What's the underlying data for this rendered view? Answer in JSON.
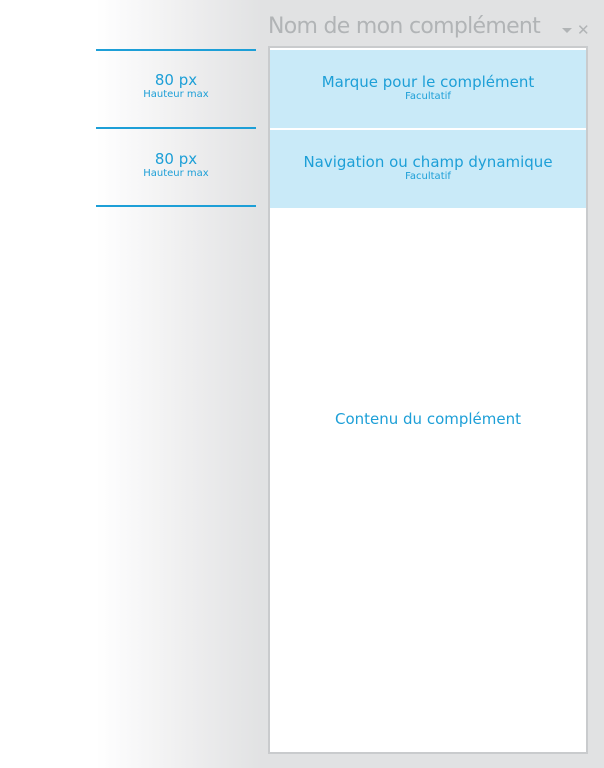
{
  "header": {
    "title": "Nom de mon complément",
    "dropdown_icon": "chevron-down-icon",
    "close_icon": "close-icon",
    "close_glyph": "✕"
  },
  "bands": [
    {
      "title": "Marque pour le complément",
      "subtitle": "Facultatif"
    },
    {
      "title": "Navigation ou champ dynamique",
      "subtitle": "Facultatif"
    }
  ],
  "content": {
    "label": "Contenu du complément"
  },
  "measurements": [
    {
      "value": "80 px",
      "label": "Hauteur max"
    },
    {
      "value": "80 px",
      "label": "Hauteur max"
    }
  ],
  "colors": {
    "accent": "#1d9fd7",
    "band_bg": "#c9eaf8",
    "title_text": "#b1b4b6",
    "pane_border": "#c9cbcd",
    "side_bg": "#e1e2e3"
  }
}
